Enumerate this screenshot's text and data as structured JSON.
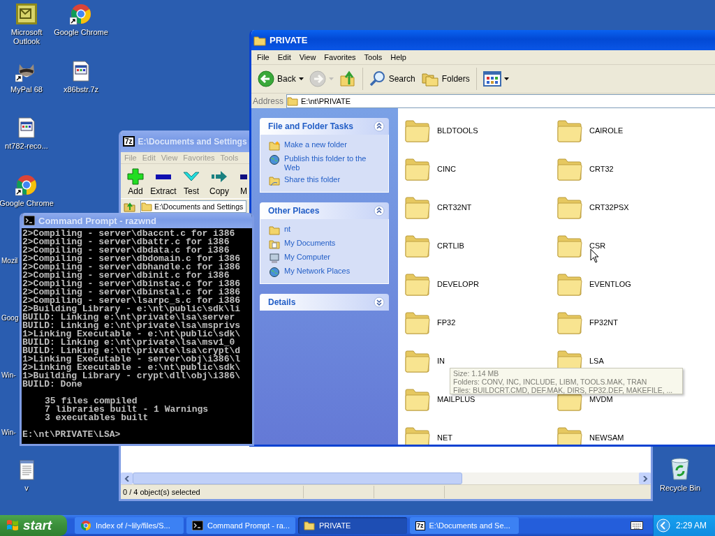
{
  "desktop_icons": [
    {
      "label": "Microsoft Outlook",
      "kind": "outlook"
    },
    {
      "label": "Google Chrome",
      "kind": "chrome",
      "shortcut": true
    },
    {
      "label": "MyPal 68",
      "kind": "raccoon",
      "shortcut": true
    },
    {
      "label": "x86bstr.7z",
      "kind": "file"
    },
    {
      "label": "nt782-reco...",
      "kind": "file"
    },
    {
      "label": "Google Chrome",
      "kind": "chrome",
      "shortcut": true
    },
    {
      "label": "Mozil",
      "kind": "hidden"
    },
    {
      "label": "Goog",
      "kind": "hidden"
    },
    {
      "label": "Win-",
      "kind": "hidden"
    },
    {
      "label": "Win-",
      "kind": "hidden"
    },
    {
      "label": "v",
      "kind": "notepad"
    },
    {
      "label": "Recycle Bin",
      "kind": "recycle"
    }
  ],
  "zip_window": {
    "logo": "7z",
    "title": "E:\\Documents and Settings",
    "active": false,
    "menu": [
      "File",
      "Edit",
      "View",
      "Favorites",
      "Tools"
    ],
    "toolbar": [
      {
        "kind": "add",
        "label": "Add"
      },
      {
        "kind": "extract",
        "label": "Extract"
      },
      {
        "kind": "test",
        "label": "Test"
      },
      {
        "kind": "copy",
        "label": "Copy"
      },
      {
        "kind": "move",
        "label": "M"
      }
    ],
    "address": "E:\\Documents and Settings",
    "status": "0 / 4 object(s) selected"
  },
  "explorer": {
    "title": "PRIVATE",
    "active": true,
    "menu": [
      "File",
      "Edit",
      "View",
      "Favorites",
      "Tools",
      "Help"
    ],
    "toolbar": [
      {
        "kind": "back",
        "label": "Back",
        "disabled": false,
        "dropdown": true
      },
      {
        "kind": "forward",
        "disabled": true,
        "dropdown": true
      },
      {
        "kind": "up",
        "disabled": false,
        "dropdown": false
      },
      {
        "kind": "search",
        "label": "Search",
        "disabled": false,
        "dropdown": false
      },
      {
        "kind": "folders",
        "label": "Folders",
        "disabled": false,
        "dropdown": false
      },
      {
        "kind": "views",
        "disabled": false,
        "dropdown": true
      }
    ],
    "address_label": "Address",
    "address": "E:\\nt\\PRIVATE",
    "task_panels": [
      {
        "title": "File and Folder Tasks",
        "expanded": true,
        "items": [
          {
            "kind": "new-folder",
            "label": "Make a new folder"
          },
          {
            "kind": "publish",
            "label": "Publish this folder to the Web"
          },
          {
            "kind": "share",
            "label": "Share this folder"
          }
        ]
      },
      {
        "title": "Other Places",
        "expanded": true,
        "items": [
          {
            "kind": "folder",
            "label": "nt"
          },
          {
            "kind": "documents",
            "label": "My Documents"
          },
          {
            "kind": "computer",
            "label": "My Computer"
          },
          {
            "kind": "network",
            "label": "My Network Places"
          }
        ]
      },
      {
        "title": "Details",
        "expanded": false
      }
    ],
    "folders": [
      "BLDTOOLS",
      "CAIROLE",
      "CINC",
      "CRT32",
      "CRT32NT",
      "CRT32PSX",
      "CRTLIB",
      "CSR",
      "DEVELOPR",
      "EVENTLOG",
      "FP32",
      "FP32NT",
      "IN",
      "LSA",
      "MAILPLUS",
      "MVDM",
      "NET",
      "NEWSAM"
    ]
  },
  "tooltip": {
    "lines": [
      "Size: 1.14 MB",
      "Folders: CONV, INC, INCLUDE, LIBM, TOOLS.MAK, TRAN",
      "Files: BUILDCRT.CMD, DEF.MAK, DIRS, FP32.DEF, MAKEFILE, ..."
    ]
  },
  "cmd": {
    "title": "Command Prompt - razwnd",
    "active": false,
    "output": [
      "2>Compiling - server\\dbaccnt.c for i386",
      "2>Compiling - server\\dbattr.c for i386",
      "2>Compiling - server\\dbdata.c for i386",
      "2>Compiling - server\\dbdomain.c for i386",
      "2>Compiling - server\\dbhandle.c for i386",
      "2>Compiling - server\\dbinit.c for i386",
      "2>Compiling - server\\dbinstac.c for i386",
      "2>Compiling - server\\dbinstal.c for i386",
      "2>Compiling - server\\lsarpc_s.c for i386",
      "2>Building Library - e:\\nt\\public\\sdk\\li",
      "BUILD: Linking e:\\nt\\private\\lsa\\server",
      "BUILD: Linking e:\\nt\\private\\lsa\\msprivs",
      "1>Linking Executable - e:\\nt\\public\\sdk\\",
      "BUILD: Linking e:\\nt\\private\\lsa\\msv1_0",
      "BUILD: Linking e:\\nt\\private\\lsa\\crypt\\d",
      "1>Linking Executable - server\\obj\\i386\\l",
      "2>Linking Executable - e:\\nt\\public\\sdk\\",
      "1>Building Library - crypt\\dll\\obj\\i386\\",
      "BUILD: Done"
    ],
    "summary": [
      "35 files compiled",
      "7 libraries built - 1 Warnings",
      "3 executables built"
    ],
    "prompt": "E:\\nt\\PRIVATE\\LSA>"
  },
  "taskbar": {
    "start": "start",
    "tasks": [
      {
        "kind": "browser",
        "label": "Index of /~lily/files/S...",
        "selected": false
      },
      {
        "kind": "console",
        "label": "Command Prompt - ra...",
        "selected": false
      },
      {
        "kind": "folder",
        "label": "PRIVATE",
        "selected": true
      },
      {
        "kind": "archiver",
        "logo": "7z",
        "label": "E:\\Documents and Se...",
        "selected": false
      }
    ],
    "clock": "2:29 AM"
  }
}
